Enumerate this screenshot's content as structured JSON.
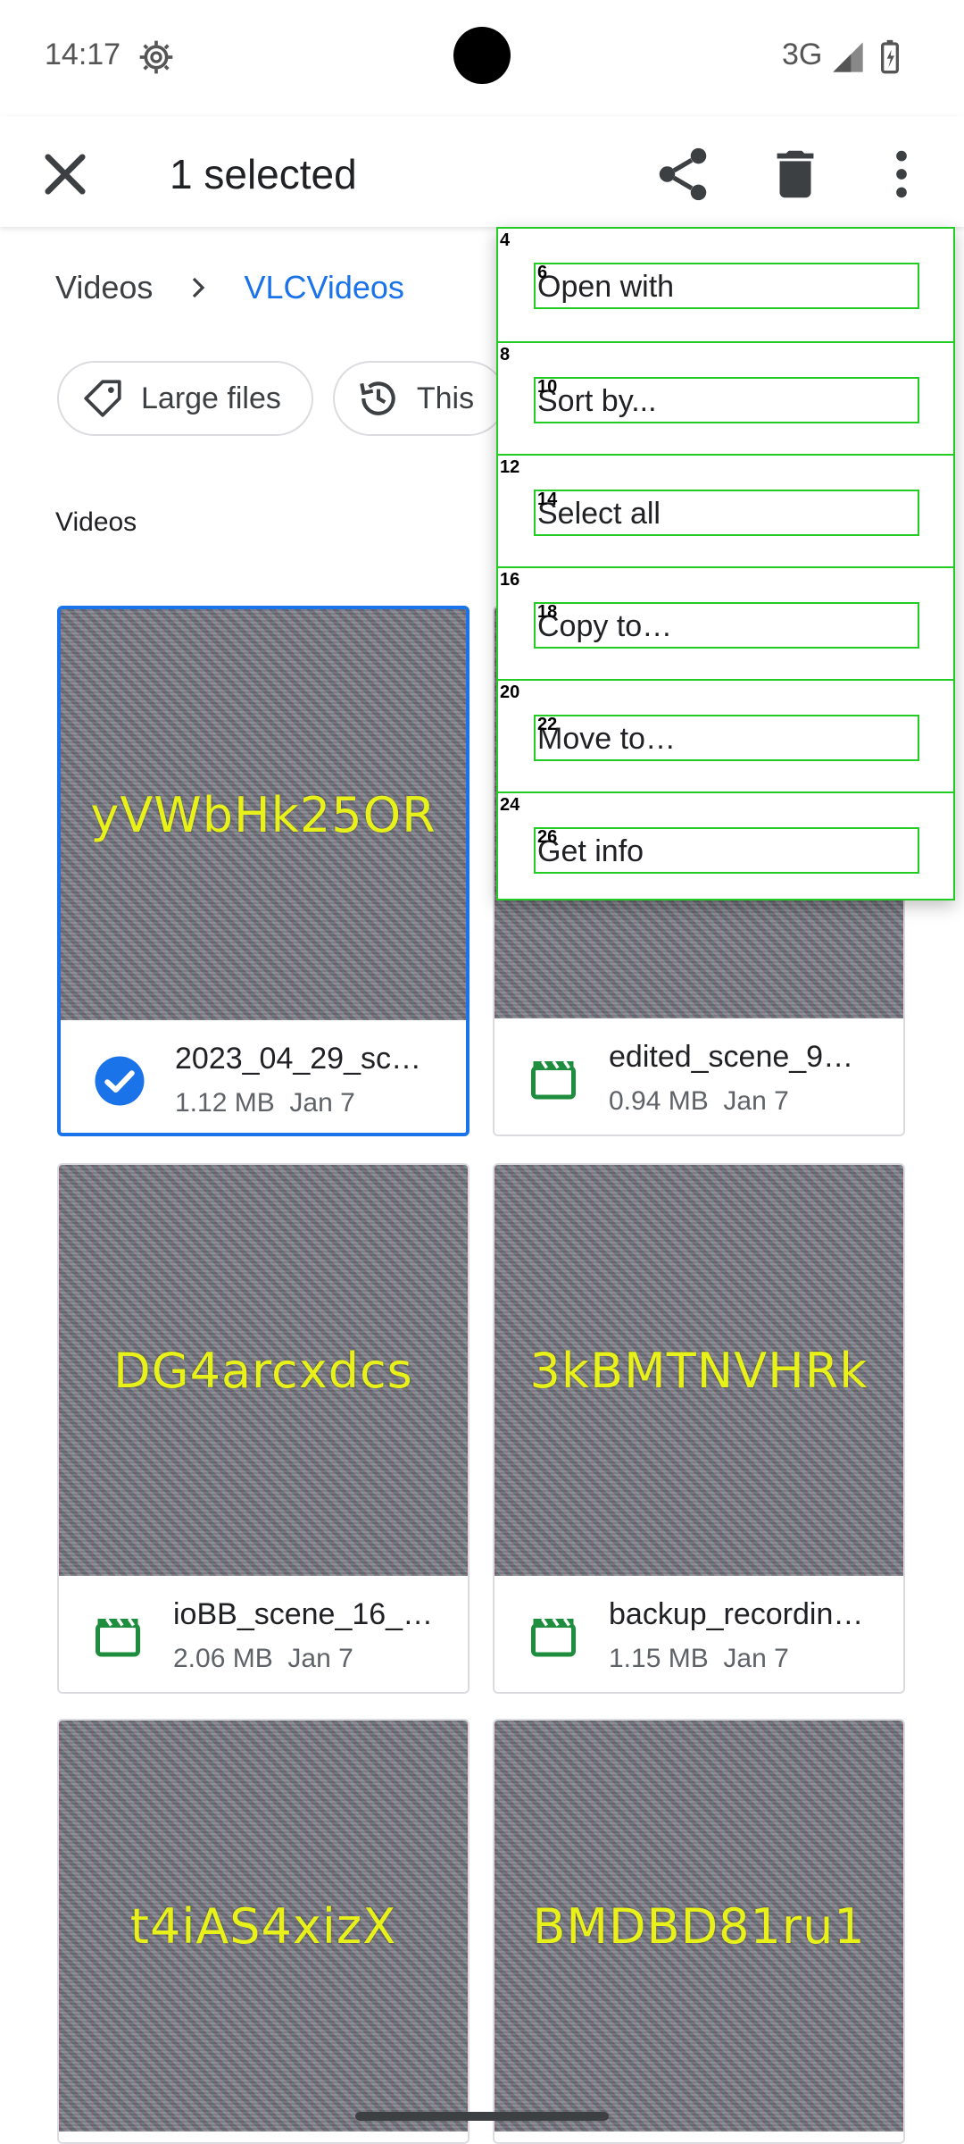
{
  "status_bar": {
    "time": "14:17",
    "network": "3G"
  },
  "app_bar": {
    "title": "1 selected"
  },
  "breadcrumb": {
    "items": [
      "Videos",
      "VLCVideos"
    ]
  },
  "chips": [
    {
      "label": "Large files",
      "icon": "tag-icon"
    },
    {
      "label": "This",
      "icon": "history-icon"
    }
  ],
  "section": {
    "title": "Videos"
  },
  "files": [
    {
      "thumb_text": "yVWbHk25OR",
      "name": "2023_04_29_sc…",
      "size": "1.12 MB",
      "date": "Jan 7",
      "selected": true
    },
    {
      "thumb_text": "",
      "name": "edited_scene_9…",
      "size": "0.94 MB",
      "date": "Jan 7",
      "selected": false
    },
    {
      "thumb_text": "DG4arcxdcs",
      "name": "ioBB_scene_16_…",
      "size": "2.06 MB",
      "date": "Jan 7",
      "selected": false
    },
    {
      "thumb_text": "3kBMTNVHRk",
      "name": "backup_recordin…",
      "size": "1.15 MB",
      "date": "Jan 7",
      "selected": false
    },
    {
      "thumb_text": "t4iAS4xizX",
      "name": "",
      "size": "",
      "date": "",
      "selected": false
    },
    {
      "thumb_text": "BMDBD81ru1",
      "name": "",
      "size": "",
      "date": "",
      "selected": false
    }
  ],
  "menu": {
    "items": [
      {
        "label": "Open with",
        "n1": "4",
        "n2": "6"
      },
      {
        "label": "Sort by...",
        "n1": "8",
        "n2": "10"
      },
      {
        "label": "Select all",
        "n1": "12",
        "n2": "14"
      },
      {
        "label": "Copy to…",
        "n1": "16",
        "n2": "18"
      },
      {
        "label": "Move to…",
        "n1": "20",
        "n2": "22"
      },
      {
        "label": "Get info",
        "n1": "24",
        "n2": "26"
      }
    ]
  },
  "colors": {
    "accent": "#1a73e8",
    "video_icon": "#1e8e3e",
    "overlay_box": "#22cc22"
  }
}
